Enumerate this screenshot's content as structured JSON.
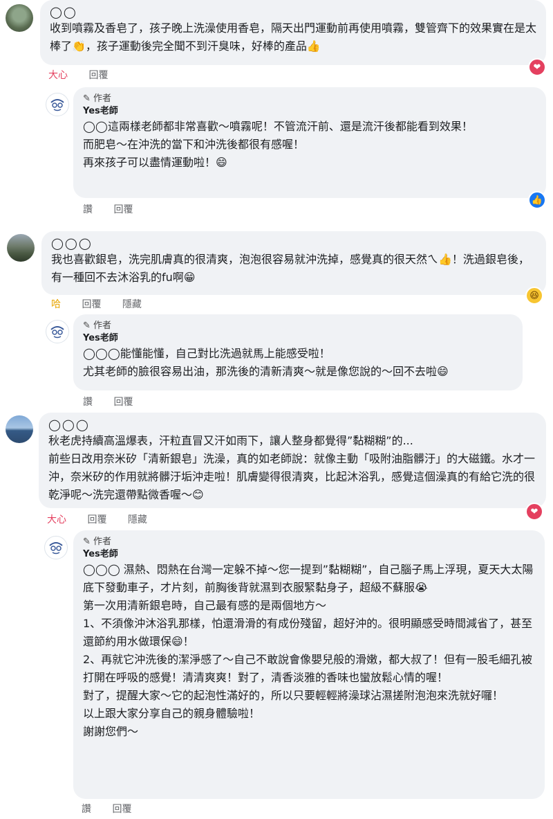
{
  "comments": [
    {
      "name": "◯◯",
      "text": "收到噴霧及香皂了，孩子晚上洗澡使用香皂，隔天出門運動前再使用噴霧，雙管齊下的效果實在是太棒了👏，孩子運動後完全聞不到汗臭味，好棒的產品👍",
      "actions": [
        "大心",
        "回覆"
      ],
      "reaction": "❤",
      "reply": {
        "badge": "作者",
        "name": "Yes老師",
        "text": "◯◯這兩樣老師都非常喜歡～噴霧呢！不管流汗前、還是流汗後都能看到效果！\n而肥皂～在沖洗的當下和沖洗後都很有感喔！\n再來孩子可以盡情運動啦！😄",
        "actions": [
          "讚",
          "回覆"
        ],
        "reaction": "👍"
      }
    },
    {
      "name": "◯◯◯",
      "text": "我也喜歡銀皂，洗完肌膚真的很清爽，泡泡很容易就沖洗掉，感覺真的很天然ㄟ👍！洗過銀皂後，有一種回不去沐浴乳的fu啊😁",
      "actions": [
        "哈",
        "回覆",
        "隱藏"
      ],
      "reaction": "😆",
      "reply": {
        "badge": "作者",
        "name": "Yes老師",
        "text": "◯◯◯能懂能懂，自己對比洗過就馬上能感受啦！\n尤其老師的臉很容易出油，那洗後的清新清爽～就是像您說的～回不去啦😄",
        "actions": [
          "讚",
          "回覆"
        ]
      }
    },
    {
      "name": "◯◯◯",
      "text": "秋老虎持續高溫爆表，汗粒直冒又汗如雨下，讓人整身都覺得”黏糊糊”的...\n前些日改用奈米矽「清新銀皂」洗澡，真的如老師說：就像主動「吸附油脂髒汙」的大磁鐵。水才一沖，奈米矽的作用就將髒汙垢沖走啦！肌膚變得很清爽，比起沐浴乳，感覺這個澡真的有給它洗的很乾淨呢～洗完還帶點微香喔～😊",
      "actions": [
        "大心",
        "回覆",
        "隱藏"
      ],
      "reaction": "❤",
      "reply": {
        "badge": "作者",
        "name": "Yes老師",
        "text": "◯◯◯ 濕熱、悶熱在台灣一定躲不掉～您一提到”黏糊糊”，自己腦子馬上浮現，夏天大太陽底下發動車子，才片刻，前胸後背就濕到衣服緊黏身子，超級不蘇服😭\n第一次用清新銀皂時，自己最有感的是兩個地方～\n1、不須像沖沐浴乳那樣，怕還滑滑的有成份殘留，超好沖的。很明顯感受時間減省了，甚至還節約用水做環保😄！\n2、再就它沖洗後的潔淨感了～自己不敢說會像嬰兒般的滑嫩，都大叔了！但有一股毛細孔被打開在呼吸的感覺！清清爽爽！對了，清香淡雅的香味也蠻放鬆心情的喔！\n對了，提醒大家～它的起泡性滿好的，所以只要輕輕將澡球沾濕搓附泡泡來洗就好囉！\n以上跟大家分享自己的親身體驗啦！\n謝謝您們～",
        "actions": [
          "讚",
          "回覆"
        ]
      }
    }
  ]
}
